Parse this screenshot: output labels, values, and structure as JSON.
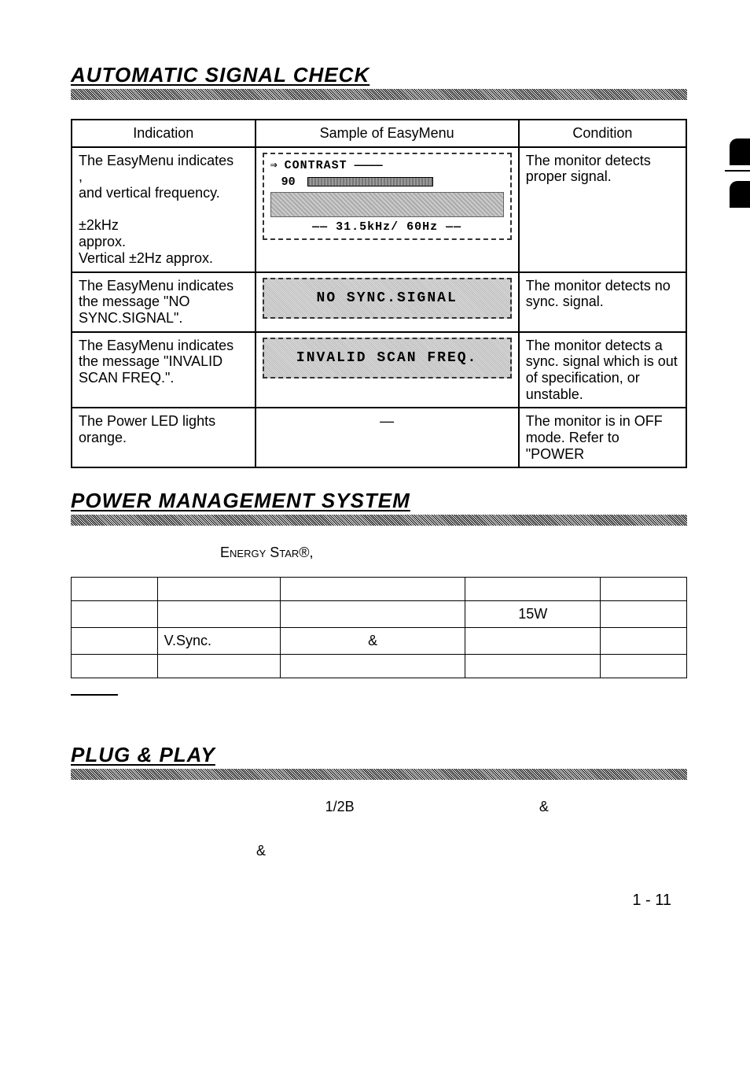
{
  "sections": {
    "auto_signal": "AUTOMATIC SIGNAL CHECK",
    "power_mgmt": "POWER MANAGEMENT SYSTEM",
    "plug_play": "PLUG & PLAY"
  },
  "signal_table": {
    "headers": {
      "indication": "Indication",
      "sample": "Sample of EasyMenu",
      "condition": "Condition"
    },
    "rows": [
      {
        "indication": "The EasyMenu indicates\n                      ,\nand vertical frequency.\n\n              ±2kHz\napprox.\nVertical  ±2Hz approx.",
        "osd": {
          "title": "CONTRAST",
          "value": "90",
          "footer": "31.5kHz/ 60Hz"
        },
        "condition": "The monitor detects proper signal."
      },
      {
        "indication": "The EasyMenu indicates the message \"NO SYNC.SIGNAL\".",
        "banner": "NO SYNC.SIGNAL",
        "condition": "The monitor detects no sync. signal."
      },
      {
        "indication": "The EasyMenu indicates the message \"INVALID SCAN FREQ.\".",
        "banner": "INVALID SCAN FREQ.",
        "condition": "The monitor detects a sync. signal which is out of specification, or unstable."
      },
      {
        "indication": "The Power LED lights orange.",
        "dash": "—",
        "condition": "The monitor is in OFF mode. Refer to \"POWER"
      }
    ]
  },
  "power": {
    "intro": "Energy Star®,",
    "table": {
      "r1c3": "15W",
      "r2c1": "V.Sync.",
      "r2c2": "&"
    }
  },
  "plug": {
    "line1_a": "1/2B",
    "line1_b": "&",
    "line2": "&"
  },
  "page_number": "1 - 11"
}
